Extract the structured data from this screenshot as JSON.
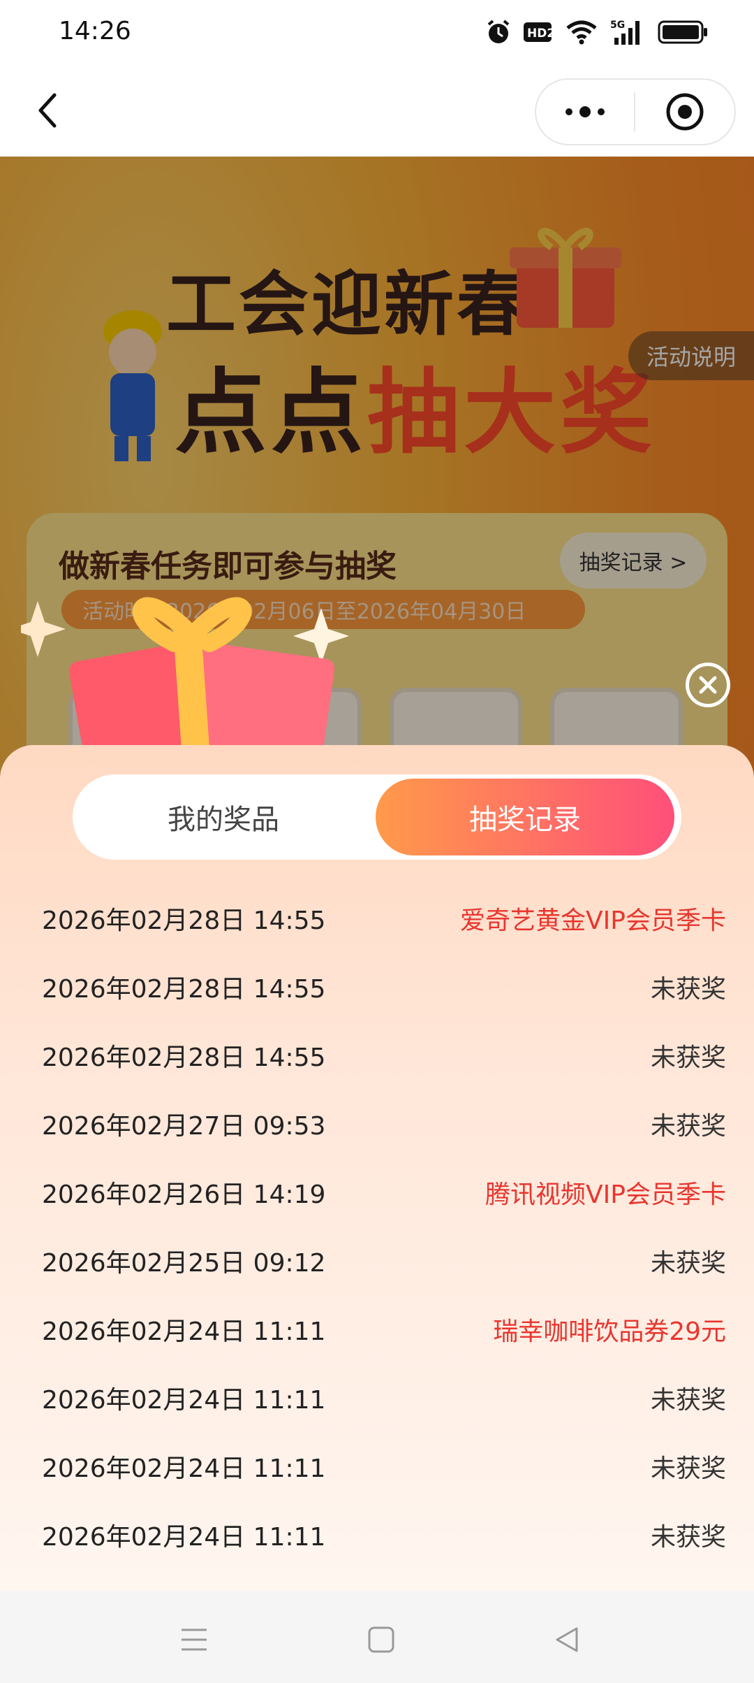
{
  "status_bar": {
    "time": "14:26",
    "icons": [
      "alarm-icon",
      "hd-icon",
      "wifi-icon",
      "5g-signal-icon",
      "battery-icon"
    ],
    "hd_label": "HD2",
    "signal_label": "5G"
  },
  "nav": {
    "back_icon": "chevron-left-icon",
    "more_icon": "more-dots-icon",
    "close_icon": "target-circle-icon"
  },
  "background": {
    "hero_line1": "工会迎新春",
    "hero_line2_a": "点点",
    "hero_line2_b": "抽大奖",
    "activity_button": "活动说明",
    "task_title": "做新春任务即可参与抽奖",
    "record_button": "抽奖记录 >",
    "date_range": "活动时间2026年02月06日至2026年04月30日"
  },
  "sheet": {
    "tabs": [
      {
        "label": "我的奖品",
        "active": false
      },
      {
        "label": "抽奖记录",
        "active": true
      }
    ],
    "records": [
      {
        "date": "2026年02月28日 14:55",
        "result": "爱奇艺黄金VIP会员季卡",
        "won": true
      },
      {
        "date": "2026年02月28日 14:55",
        "result": "未获奖",
        "won": false
      },
      {
        "date": "2026年02月28日 14:55",
        "result": "未获奖",
        "won": false
      },
      {
        "date": "2026年02月27日 09:53",
        "result": "未获奖",
        "won": false
      },
      {
        "date": "2026年02月26日 14:19",
        "result": "腾讯视频VIP会员季卡",
        "won": true
      },
      {
        "date": "2026年02月25日 09:12",
        "result": "未获奖",
        "won": false
      },
      {
        "date": "2026年02月24日 11:11",
        "result": "瑞幸咖啡饮品券29元",
        "won": true
      },
      {
        "date": "2026年02月24日 11:11",
        "result": "未获奖",
        "won": false
      },
      {
        "date": "2026年02月24日 11:11",
        "result": "未获奖",
        "won": false
      },
      {
        "date": "2026年02月24日 11:11",
        "result": "未获奖",
        "won": false
      }
    ]
  },
  "colors": {
    "accent_gradient_start": "#ff9a4a",
    "accent_gradient_end": "#ff4f7a",
    "won_text": "#e8362f"
  },
  "system_nav": {
    "icons": [
      "menu-icon",
      "home-square-icon",
      "back-triangle-icon"
    ]
  }
}
